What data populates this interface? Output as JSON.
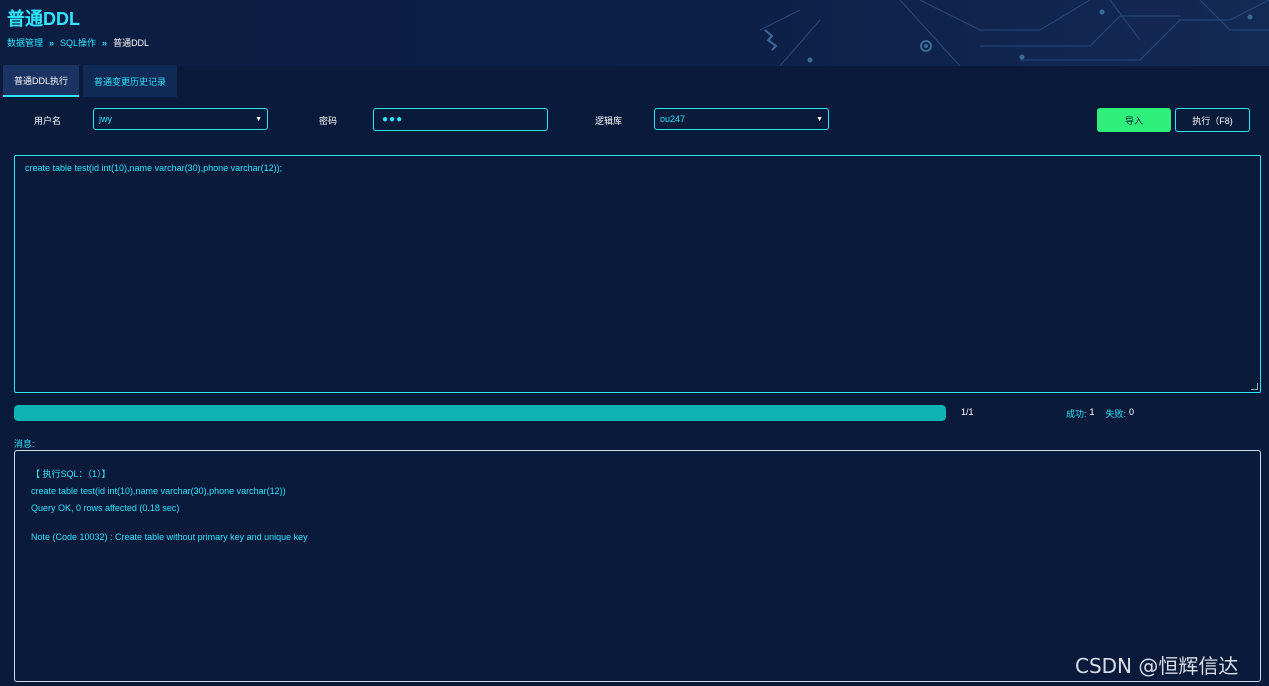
{
  "header": {
    "title": "普通DDL",
    "breadcrumb": [
      "数据管理",
      "SQL操作",
      "普通DDL"
    ],
    "separator": "»"
  },
  "tabs": [
    {
      "label": "普通DDL执行",
      "active": true
    },
    {
      "label": "普通变更历史记录",
      "active": false
    }
  ],
  "form": {
    "username_label": "用户名",
    "username_value": "jwy",
    "password_label": "密码",
    "password_value": "●●●",
    "db_label": "逻辑库",
    "db_value": "ou247",
    "import_button": "导入",
    "execute_button": "执行（F8)"
  },
  "editor": {
    "content": "create table test(id int(10),name varchar(30),phone varchar(12));"
  },
  "progress": {
    "fraction": 1.0,
    "text": "1/1",
    "success_label": "成功:",
    "success_value": "1",
    "fail_label": "失败:",
    "fail_value": "0"
  },
  "messages": {
    "label": "消息:",
    "header": "【 执行SQL：（1）】",
    "sql": "create table test(id int(10),name varchar(30),phone varchar(12))",
    "result": "Query OK, 0 rows affected (0.18 sec)",
    "note": "Note (Code 10032) : Create table without primary key and unique key"
  },
  "watermark": "CSDN @恒辉信达",
  "colors": {
    "accent": "#2ee6ff",
    "background": "#0a1a3a",
    "import_button": "#2ef07a",
    "progress_fill": "#0eb3b3"
  }
}
